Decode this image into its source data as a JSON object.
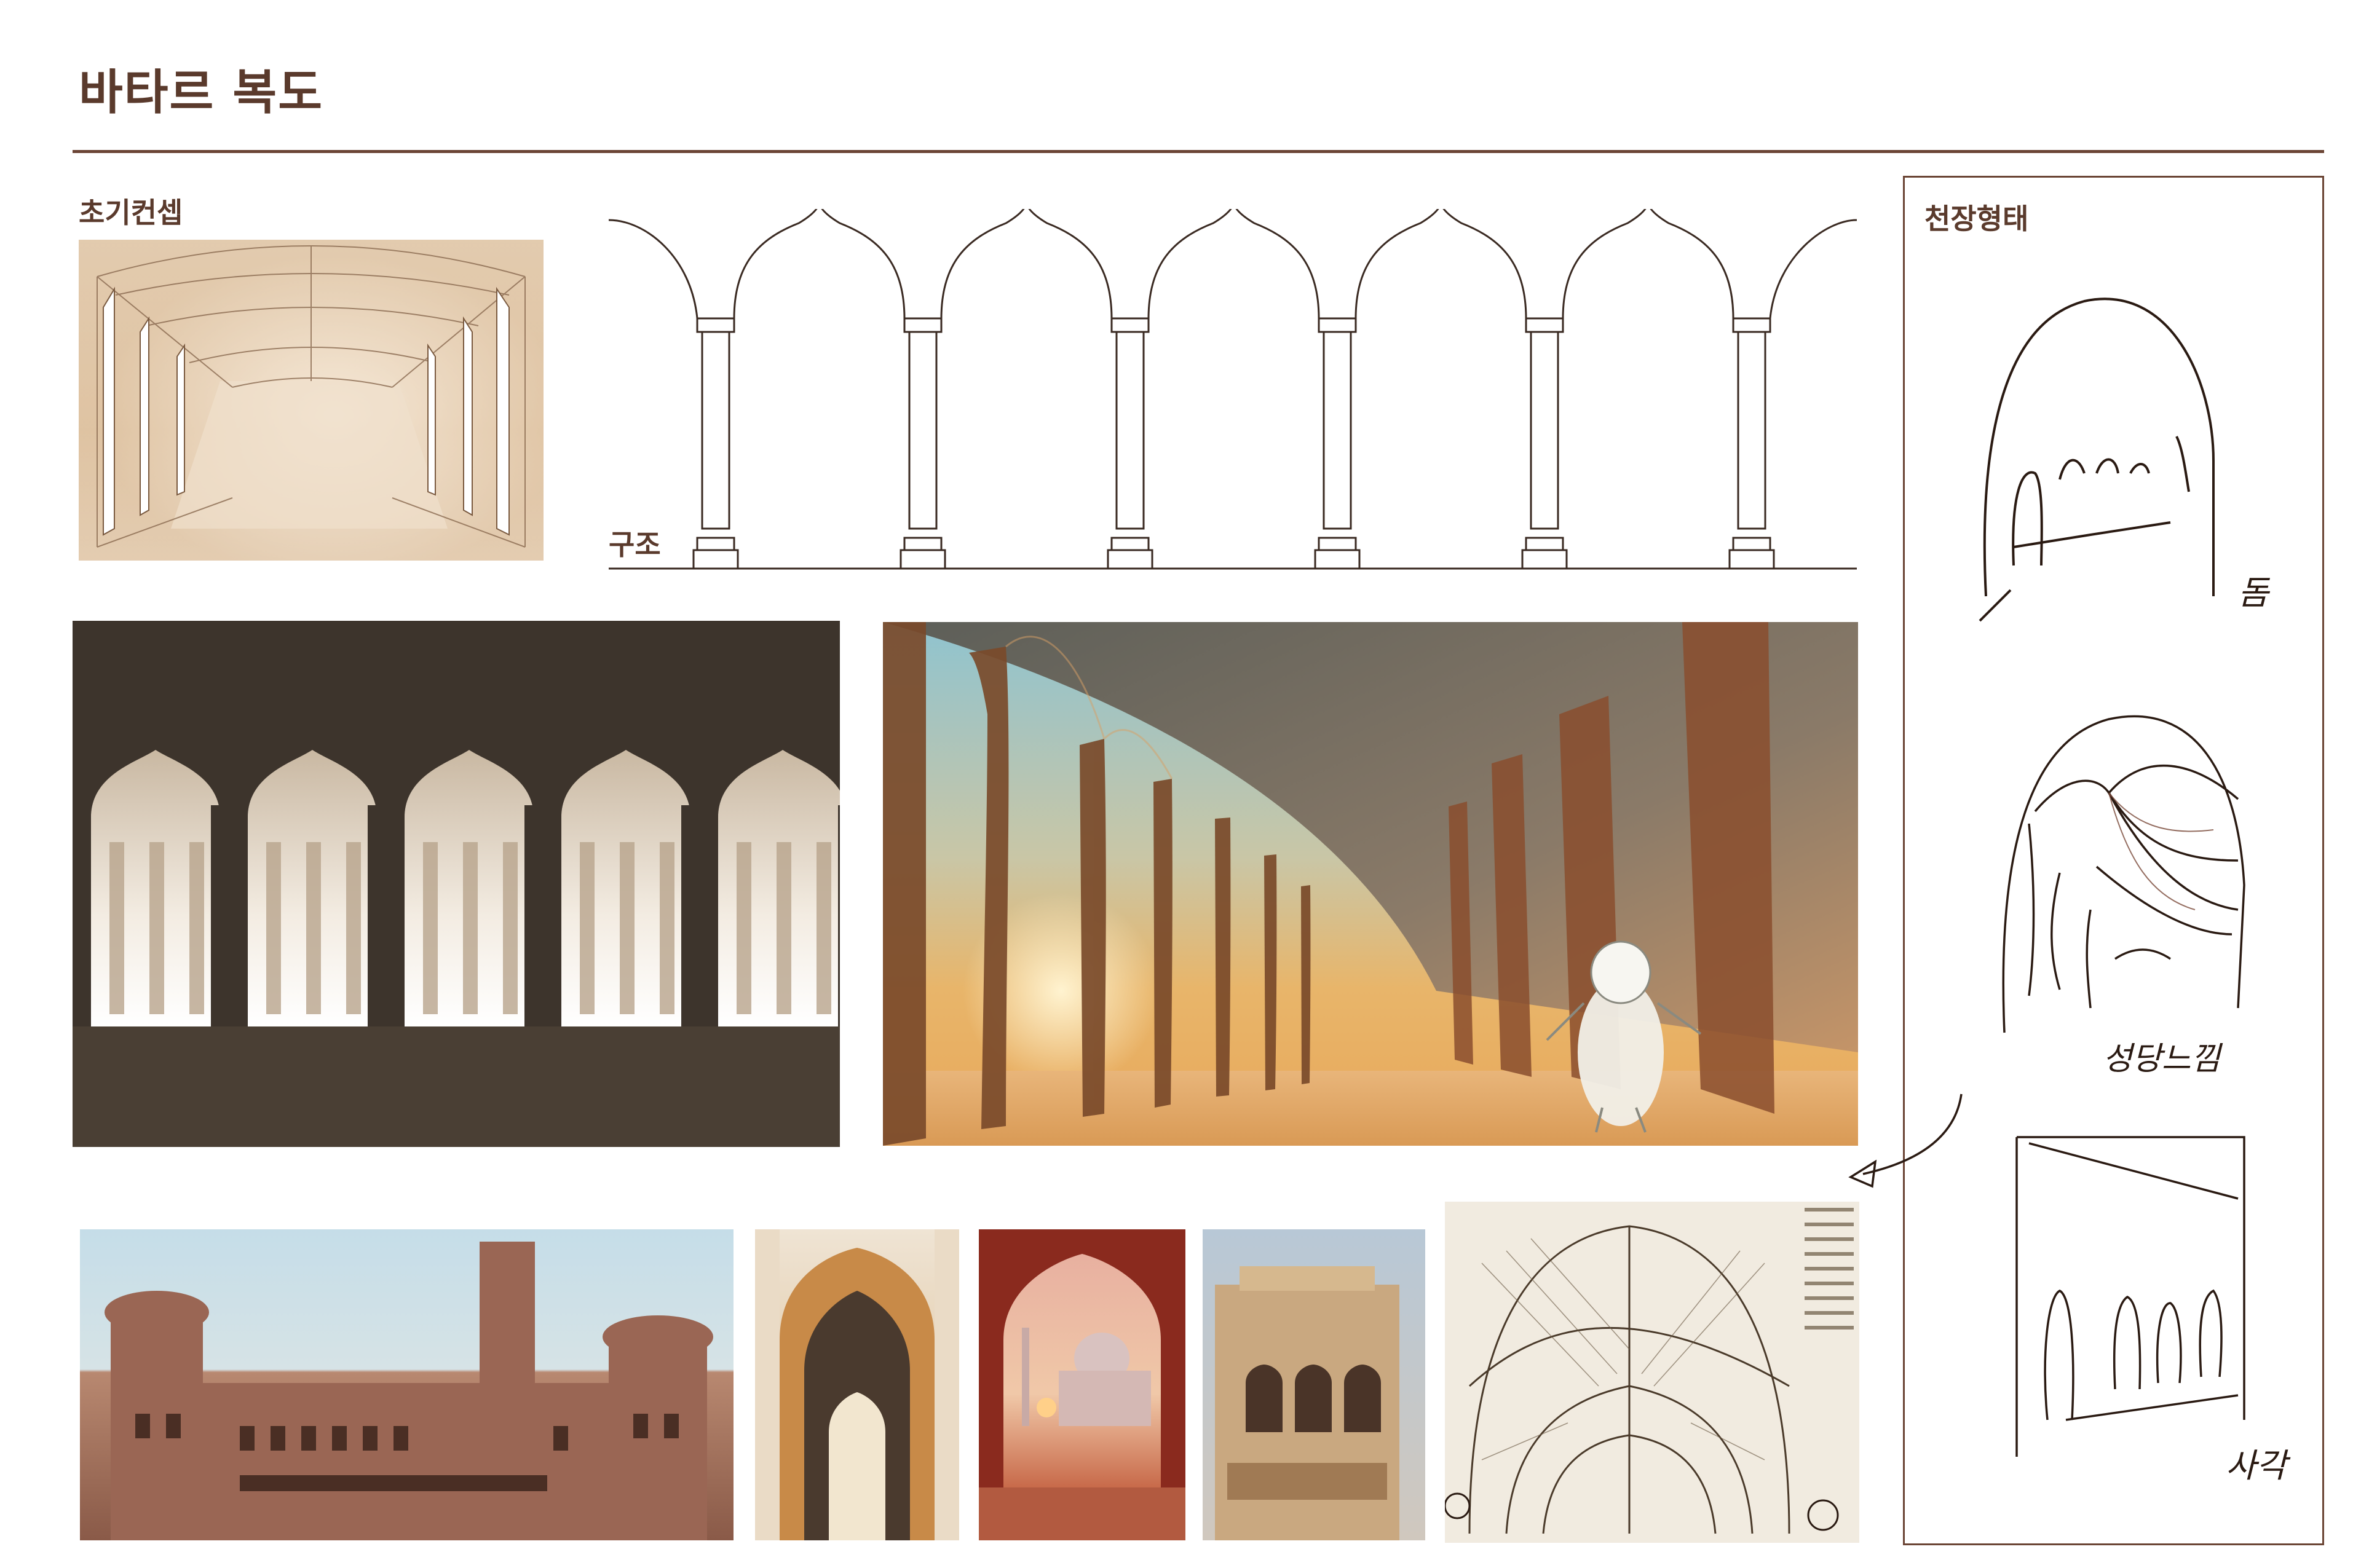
{
  "page": {
    "title": "바타르 복도"
  },
  "sections": {
    "concept_label": "초기컨셉",
    "structure_label": "구조",
    "ceiling_label": "천장형태"
  },
  "ceiling_sketches": [
    {
      "label": "돔"
    },
    {
      "label": "성당느낌"
    },
    {
      "label": "사각"
    }
  ],
  "reference_photos": [
    {
      "subject": "palace-facade"
    },
    {
      "subject": "ornate-archway"
    },
    {
      "subject": "taj-mahal-through-arch"
    },
    {
      "subject": "carved-balcony"
    },
    {
      "subject": "gothic-vault-engraving"
    }
  ],
  "colors": {
    "accent": "#5a3a2c",
    "rule": "#6b4535",
    "dark_panel": "#3d342c",
    "sand": "#e8c48e",
    "sky": "#8fc3cf"
  }
}
